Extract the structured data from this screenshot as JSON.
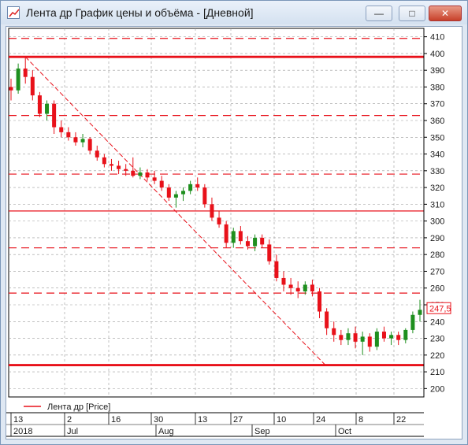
{
  "window": {
    "title": "Лента др График цены и объёма - [Дневной]",
    "minimize_icon": "minimize-icon",
    "maximize_icon": "maximize-icon",
    "close_icon": "close-icon"
  },
  "legend": {
    "label": "Лента др [Price]",
    "color": "#e8111a"
  },
  "colors": {
    "up": "#1e8f1e",
    "down": "#e8111a",
    "line": "#e8111a"
  },
  "last_price": "247,5",
  "chart_data": {
    "type": "candlestick",
    "title": "",
    "ylim": [
      195,
      415
    ],
    "y_ticks": [
      200,
      210,
      220,
      230,
      240,
      250,
      260,
      270,
      280,
      290,
      300,
      310,
      320,
      330,
      340,
      350,
      360,
      370,
      380,
      390,
      400,
      410
    ],
    "x_day_labels": [
      "13",
      "2",
      "16",
      "30",
      "13",
      "27",
      "10",
      "24",
      "8",
      "22"
    ],
    "x_month_labels": [
      "2018",
      "Jul",
      "Aug",
      "Sep",
      "Oct"
    ],
    "x_labels_note": "first row: day numbers; second row: year / month names",
    "horizontal_levels": [
      {
        "price": 409,
        "style": "dashed"
      },
      {
        "price": 398,
        "style": "solid-thick"
      },
      {
        "price": 363,
        "style": "dashed"
      },
      {
        "price": 328,
        "style": "dashed"
      },
      {
        "price": 306,
        "style": "solid"
      },
      {
        "price": 284,
        "style": "dashed"
      },
      {
        "price": 257,
        "style": "dashed"
      },
      {
        "price": 214,
        "style": "solid-thick"
      }
    ],
    "trendline": {
      "start_price": 398,
      "end_price": 214
    },
    "candles": [
      [
        380,
        385,
        372,
        378
      ],
      [
        378,
        394,
        376,
        391
      ],
      [
        391,
        398,
        382,
        386
      ],
      [
        386,
        390,
        372,
        375
      ],
      [
        375,
        377,
        362,
        364
      ],
      [
        364,
        372,
        360,
        370
      ],
      [
        370,
        372,
        352,
        356
      ],
      [
        356,
        360,
        350,
        353
      ],
      [
        353,
        356,
        348,
        350
      ],
      [
        350,
        353,
        345,
        347
      ],
      [
        347,
        352,
        344,
        349
      ],
      [
        349,
        350,
        340,
        342
      ],
      [
        342,
        345,
        336,
        338
      ],
      [
        338,
        340,
        332,
        334
      ],
      [
        334,
        337,
        330,
        333
      ],
      [
        333,
        336,
        328,
        331
      ],
      [
        331,
        334,
        327,
        330
      ],
      [
        330,
        338,
        326,
        327
      ],
      [
        327,
        332,
        325,
        329
      ],
      [
        329,
        331,
        324,
        326
      ],
      [
        326,
        330,
        322,
        324
      ],
      [
        324,
        327,
        318,
        320
      ],
      [
        320,
        322,
        312,
        314
      ],
      [
        314,
        318,
        308,
        316
      ],
      [
        316,
        320,
        312,
        318
      ],
      [
        318,
        324,
        316,
        322
      ],
      [
        322,
        326,
        318,
        320
      ],
      [
        320,
        322,
        308,
        310
      ],
      [
        310,
        314,
        300,
        302
      ],
      [
        302,
        306,
        296,
        298
      ],
      [
        298,
        300,
        284,
        287
      ],
      [
        287,
        296,
        284,
        294
      ],
      [
        294,
        297,
        286,
        288
      ],
      [
        288,
        291,
        283,
        285
      ],
      [
        285,
        292,
        282,
        290
      ],
      [
        290,
        292,
        284,
        286
      ],
      [
        286,
        289,
        274,
        276
      ],
      [
        276,
        280,
        264,
        266
      ],
      [
        266,
        270,
        258,
        262
      ],
      [
        262,
        266,
        256,
        260
      ],
      [
        260,
        264,
        254,
        258
      ],
      [
        258,
        264,
        256,
        262
      ],
      [
        262,
        265,
        255,
        258
      ],
      [
        258,
        260,
        242,
        246
      ],
      [
        246,
        248,
        232,
        236
      ],
      [
        236,
        240,
        228,
        232
      ],
      [
        232,
        235,
        226,
        229
      ],
      [
        229,
        236,
        226,
        233
      ],
      [
        233,
        237,
        224,
        228
      ],
      [
        228,
        234,
        220,
        231
      ],
      [
        231,
        233,
        222,
        225
      ],
      [
        225,
        236,
        223,
        234
      ],
      [
        234,
        237,
        228,
        230
      ],
      [
        230,
        234,
        226,
        232
      ],
      [
        232,
        234,
        226,
        229
      ],
      [
        229,
        236,
        227,
        235
      ],
      [
        235,
        246,
        233,
        244
      ],
      [
        244,
        253,
        240,
        247
      ]
    ]
  }
}
